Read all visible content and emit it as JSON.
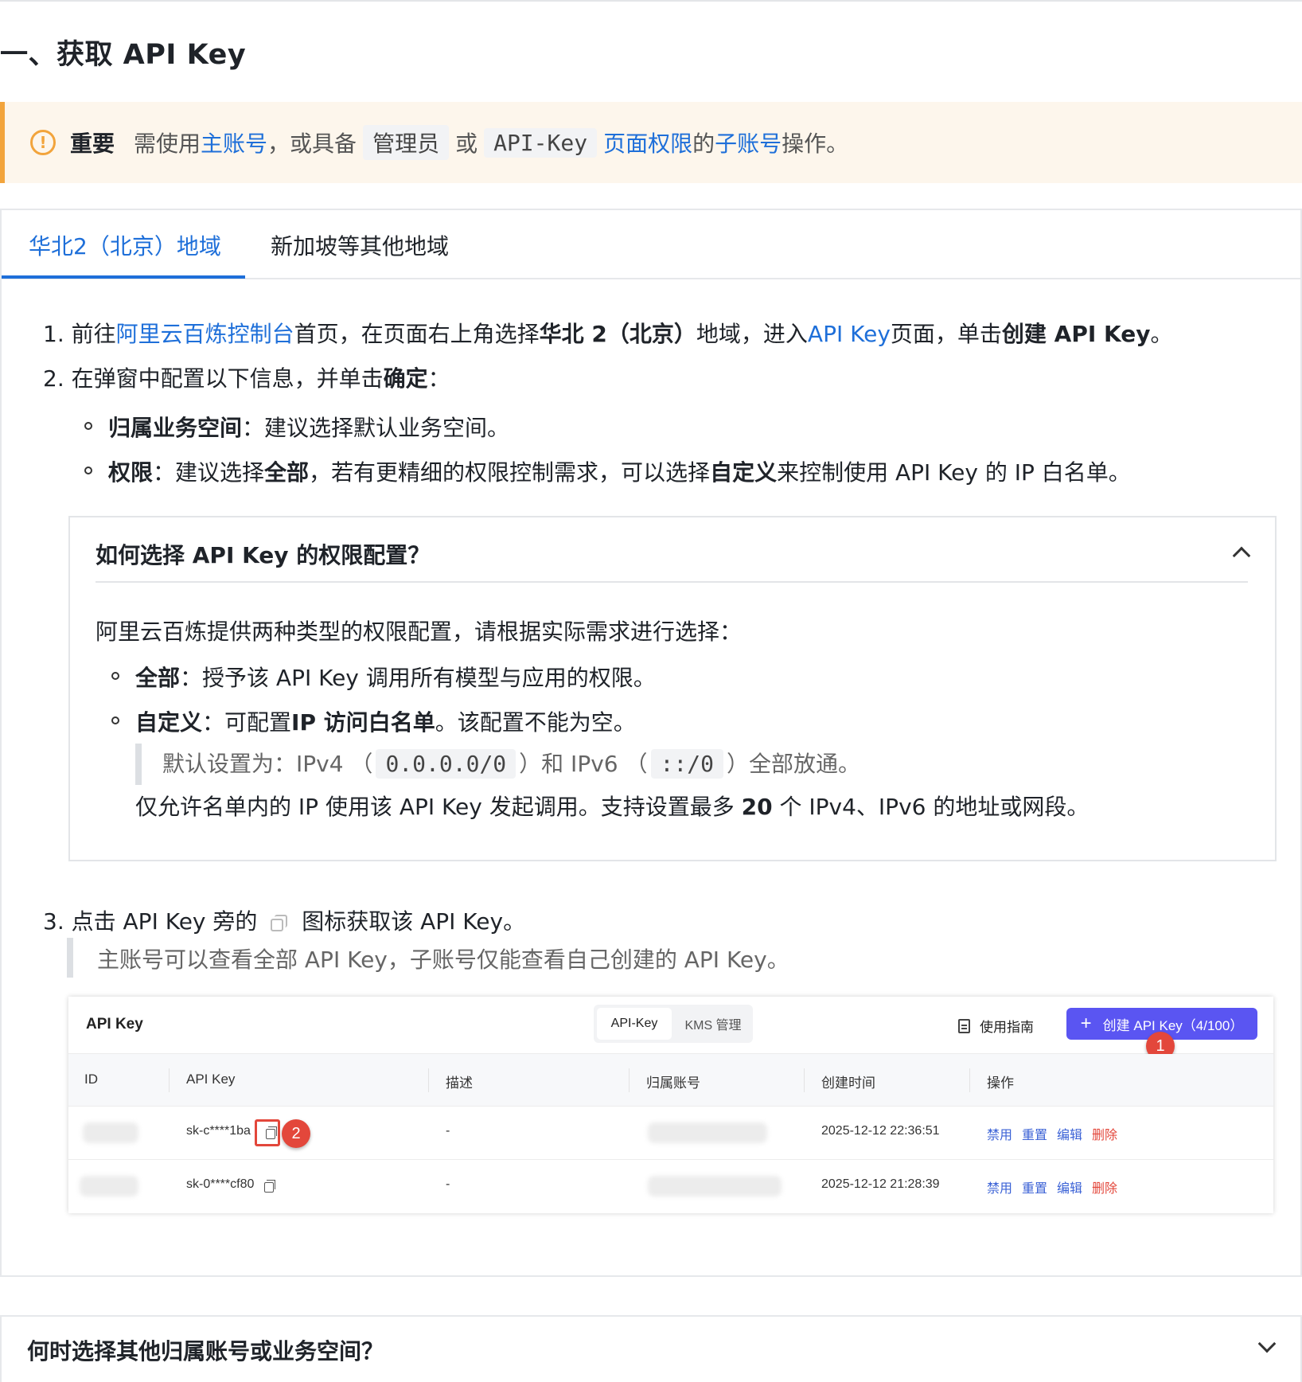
{
  "heading": "一、获取 API Key",
  "notice": {
    "label": "重要",
    "t1": "需使用",
    "link1": "主账号",
    "t2": "，或具备",
    "code1": "管理员",
    "t3": "或",
    "code2": "API-Key",
    "link2": "页面权限",
    "t4": "的",
    "link3": "子账号",
    "t5": "操作。"
  },
  "tabs": [
    "华北2（北京）地域",
    "新加坡等其他地域"
  ],
  "step1": {
    "num": "1.",
    "t1": "前往",
    "link1": "阿里云百炼控制台",
    "t2": "首页，在页面右上角选择",
    "b1": "华北 2（北京）",
    "t3": "地域，进入",
    "link2": "API Key",
    "t4": "页面，单击",
    "b2": "创建 API Key",
    "t5": "。"
  },
  "step2": {
    "num": "2.",
    "t1": "在弹窗中配置以下信息，并单击",
    "b1": "确定",
    "t2": "："
  },
  "step2_items": {
    "i1_b": "归属业务空间",
    "i1_t": "：建议选择默认业务空间。",
    "i2_b": "权限",
    "i2_t1": "：建议选择",
    "i2_b2": "全部",
    "i2_t2": "，若有更精细的权限控制需求，可以选择",
    "i2_b3": "自定义",
    "i2_t3": "来控制使用 API Key 的 IP 白名单。"
  },
  "collapse": {
    "title": "如何选择 API Key 的权限配置？",
    "intro": "阿里云百炼提供两种类型的权限配置，请根据实际需求进行选择：",
    "c1_b": "全部",
    "c1_t": "：授予该 API Key 调用所有模型与应用的权限。",
    "c2_b": "自定义",
    "c2_t1": "：可配置",
    "c2_b2": "IP 访问白名单",
    "c2_t2": "。该配置不能为空。",
    "q_t1": "默认设置为：IPv4 （",
    "q_code1": "0.0.0.0/0",
    "q_t2": "）和 IPv6 （",
    "q_code2": "::/0",
    "q_t3": "）全部放通。",
    "last_t1": "仅允许名单内的 IP 使用该 API Key 发起调用。支持设置最多",
    "last_b": "20",
    "last_t2": "个 IPv4、IPv6 的地址或网段。"
  },
  "step3": {
    "num": "3.",
    "t1": "点击 API Key 旁的",
    "t2": "图标获取该 API Key。",
    "quote": "主账号可以查看全部 API Key，子账号仅能查看自己创建的 API Key。"
  },
  "screenshot": {
    "title": "API Key",
    "seg_a": "API-Key",
    "seg_b": "KMS 管理",
    "guide": "使用指南",
    "create": "创建 API Key（4/100）",
    "badge1": "1",
    "badge2": "2",
    "columns": [
      "ID",
      "API Key",
      "描述",
      "归属账号",
      "创建时间",
      "操作"
    ],
    "rows": [
      {
        "key": "sk-c****1ba",
        "desc": "-",
        "time": "2025-12-12 22:36:51"
      },
      {
        "key": "sk-0****cf80",
        "desc": "-",
        "time": "2025-12-12 21:28:39"
      }
    ],
    "actions": [
      "禁用",
      "重置",
      "编辑",
      "删除"
    ]
  },
  "bottom_collapse": "何时选择其他归属账号或业务空间？"
}
